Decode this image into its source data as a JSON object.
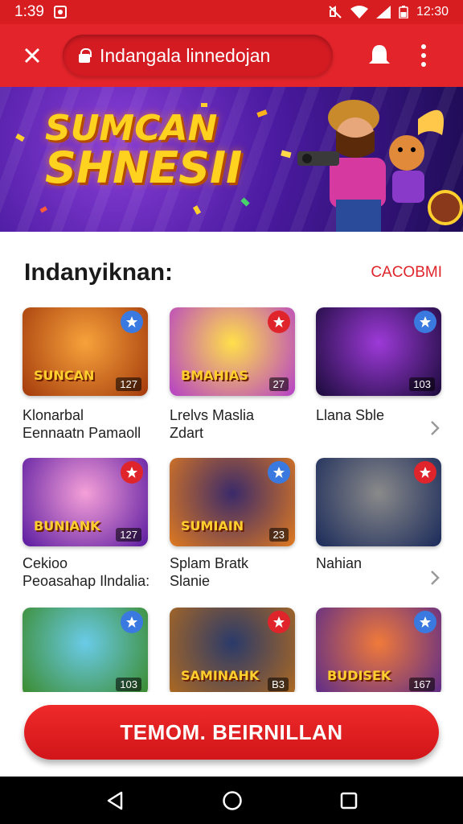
{
  "status_bar": {
    "time": "1:39",
    "right_text": "12:30"
  },
  "toolbar": {
    "url": "Indangala linnedojan"
  },
  "banner": {
    "title_line1": "SUMCAN",
    "title_line2": "SHNESII"
  },
  "section": {
    "heading": "Indanyiknan:",
    "see_all": "CACOBMI"
  },
  "games": [
    {
      "title": "Klonarbal",
      "subtitle": "Eennaatn Pamaoll",
      "count": "127",
      "logo": "SUNCAN",
      "colors": [
        "#f7a23b",
        "#a33a0c"
      ]
    },
    {
      "title": "Lrelvs Maslia",
      "subtitle": "Zdart",
      "count": "27",
      "logo": "BMAHIAS",
      "colors": [
        "#ffe04a",
        "#b53fc8"
      ]
    },
    {
      "title": "Llana Sble",
      "subtitle": "",
      "count": "103",
      "logo": "",
      "colors": [
        "#9d3ad8",
        "#1a0a3a"
      ]
    },
    {
      "title": "Cekioo",
      "subtitle": "Peoasahap Ilndalia:",
      "count": "127",
      "logo": "BUNIANK",
      "colors": [
        "#f5a0d8",
        "#5a1aa0"
      ]
    },
    {
      "title": "Splam Bratk",
      "subtitle": "Slanie",
      "count": "23",
      "logo": "SUMIAIN",
      "colors": [
        "#3a2a6a",
        "#e07a20"
      ]
    },
    {
      "title": "Nahian",
      "subtitle": "",
      "count": "",
      "logo": "",
      "colors": [
        "#8a8a8a",
        "#1a2a5a"
      ]
    },
    {
      "title": "",
      "subtitle": "",
      "count": "103",
      "logo": "",
      "colors": [
        "#6acbe8",
        "#3a8a2a"
      ]
    },
    {
      "title": "",
      "subtitle": "",
      "count": "B3",
      "logo": "SAMINAHK",
      "colors": [
        "#2a3a6a",
        "#b06a20"
      ]
    },
    {
      "title": "",
      "subtitle": "",
      "count": "167",
      "logo": "BUDISEK",
      "colors": [
        "#f07a3a",
        "#5a2a8a"
      ]
    }
  ],
  "cta": {
    "label": "TEMOM. BEIRNILLAN"
  },
  "colors": {
    "brand_red": "#e3242b",
    "status_red": "#d81d20"
  }
}
